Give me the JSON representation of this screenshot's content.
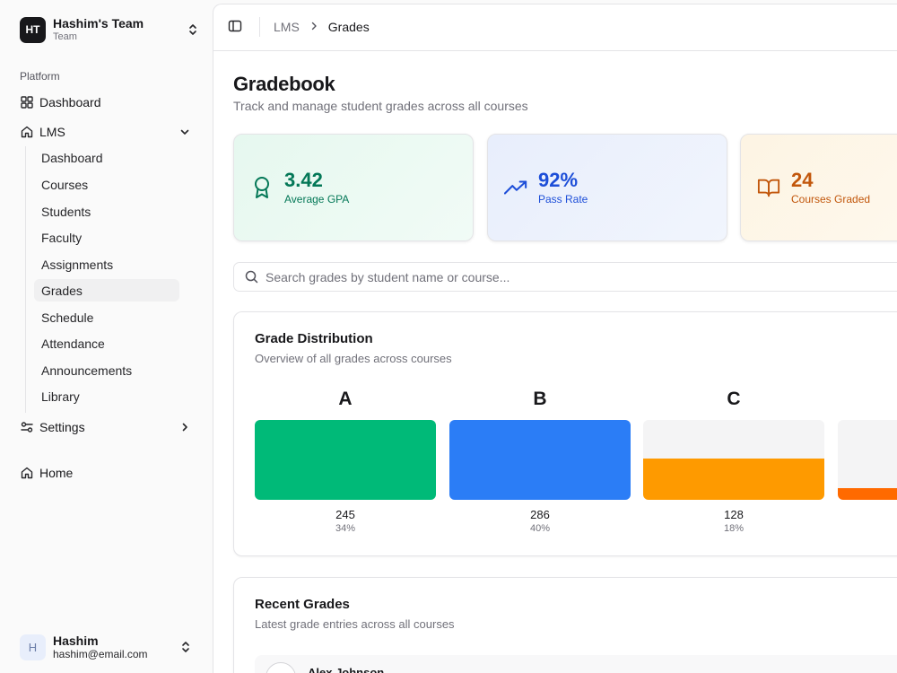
{
  "team": {
    "initials": "HT",
    "name": "Hashim's Team",
    "plan": "Team"
  },
  "sidebar": {
    "section_label": "Platform",
    "items": [
      {
        "label": "Dashboard",
        "icon": "grid-icon"
      },
      {
        "label": "LMS",
        "icon": "house-icon"
      },
      {
        "label": "Settings",
        "icon": "sliders-icon"
      },
      {
        "label": "Home",
        "icon": "house-icon"
      }
    ],
    "lms_children": [
      "Dashboard",
      "Courses",
      "Students",
      "Faculty",
      "Assignments",
      "Grades",
      "Schedule",
      "Attendance",
      "Announcements",
      "Library"
    ],
    "active_child": "Grades"
  },
  "user": {
    "initial": "H",
    "name": "Hashim",
    "email": "hashim@email.com"
  },
  "breadcrumb": {
    "parent": "LMS",
    "current": "Grades"
  },
  "page": {
    "title": "Gradebook",
    "subtitle": "Track and manage student grades across all courses"
  },
  "stats": [
    {
      "value": "3.42",
      "label": "Average GPA",
      "icon": "award-icon",
      "color": "#047857"
    },
    {
      "value": "92%",
      "label": "Pass Rate",
      "icon": "trending-up-icon",
      "color": "#1d4ed8"
    },
    {
      "value": "24",
      "label": "Courses Graded",
      "icon": "book-open-icon",
      "color": "#c2570c"
    }
  ],
  "search": {
    "placeholder": "Search grades by student name or course..."
  },
  "distribution": {
    "title": "Grade Distribution",
    "subtitle": "Overview of all grades across courses",
    "grades": [
      {
        "letter": "A",
        "count": "245",
        "percent": "34%",
        "fill": 1.0,
        "color": "#00ba78"
      },
      {
        "letter": "B",
        "count": "286",
        "percent": "40%",
        "fill": 1.0,
        "color": "#2b7df6"
      },
      {
        "letter": "C",
        "count": "128",
        "percent": "18%",
        "fill": 0.52,
        "color": "#fe9a00"
      },
      {
        "letter": "",
        "count": "",
        "percent": "",
        "fill": 0.15,
        "color": "#ff6a00"
      }
    ]
  },
  "recent": {
    "title": "Recent Grades",
    "subtitle": "Latest grade entries across all courses",
    "rows": [
      {
        "name": "Alex Johnson"
      }
    ]
  }
}
